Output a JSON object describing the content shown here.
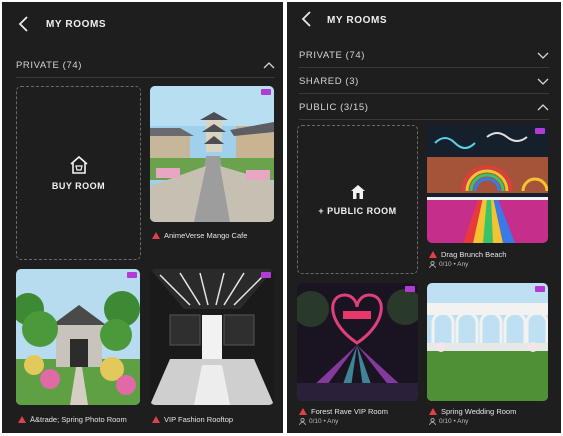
{
  "left": {
    "header": {
      "title": "MY ROOMS"
    },
    "section_private": {
      "label": "PRIVATE (74)"
    },
    "buy_room": {
      "label": "BUY ROOM"
    },
    "rooms": [
      {
        "name": "AnimeVerse Mango Cafe"
      },
      {
        "name": "Ā&trade; Spring Photo Room"
      },
      {
        "name": "VIP Fashion Rooftop"
      }
    ]
  },
  "right": {
    "header": {
      "title": "MY ROOMS"
    },
    "sections": [
      {
        "label": "PRIVATE (74)"
      },
      {
        "label": "SHARED (3)"
      },
      {
        "label": "PUBLIC (3/15)"
      }
    ],
    "public_room": {
      "label": "+ PUBLIC ROOM"
    },
    "rooms": [
      {
        "name": "Drag Brunch Beach",
        "meta": "0/10 • Any"
      },
      {
        "name": "Forest Rave VIP Room",
        "meta": "0/10 • Any"
      },
      {
        "name": "Spring Wedding Room",
        "meta": "0/10 • Any"
      }
    ]
  },
  "colors": {
    "panel_bg": "#1e1e1e",
    "warning": "#e0404a",
    "badge": "#b23bd6"
  },
  "icons": [
    "back-arrow-icon",
    "chevron-up-icon",
    "chevron-down-icon",
    "store-icon",
    "home-icon",
    "warning-icon",
    "person-icon"
  ]
}
